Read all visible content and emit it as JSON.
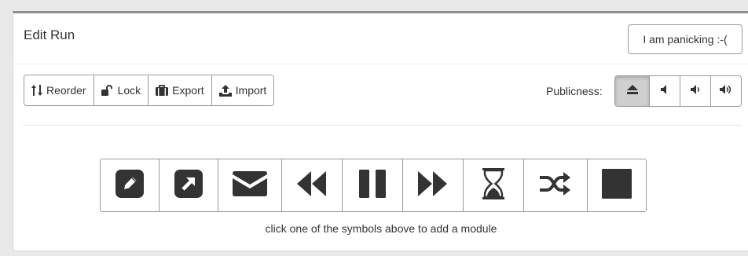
{
  "panel": {
    "title": "Edit Run",
    "panic_label": "I am panicking :-("
  },
  "toolbar": {
    "buttons": [
      {
        "label": "Reorder",
        "icon": "sort-icon"
      },
      {
        "label": "Lock",
        "icon": "unlock-icon"
      },
      {
        "label": "Export",
        "icon": "briefcase-icon"
      },
      {
        "label": "Import",
        "icon": "upload-icon"
      }
    ]
  },
  "publicness": {
    "label": "Publicness:",
    "options": [
      "eject-icon",
      "volume-off-icon",
      "volume-down-icon",
      "volume-up-icon"
    ],
    "selected": 0
  },
  "modules": {
    "items": [
      "edit-icon",
      "external-link-icon",
      "envelope-icon",
      "backward-icon",
      "pause-icon",
      "forward-icon",
      "hourglass-icon",
      "shuffle-icon",
      "stop-icon"
    ],
    "hint": "click one of the symbols above to add a module"
  },
  "colors": {
    "icon": "#3a3a3a",
    "active_button": "#cfcfcf"
  }
}
